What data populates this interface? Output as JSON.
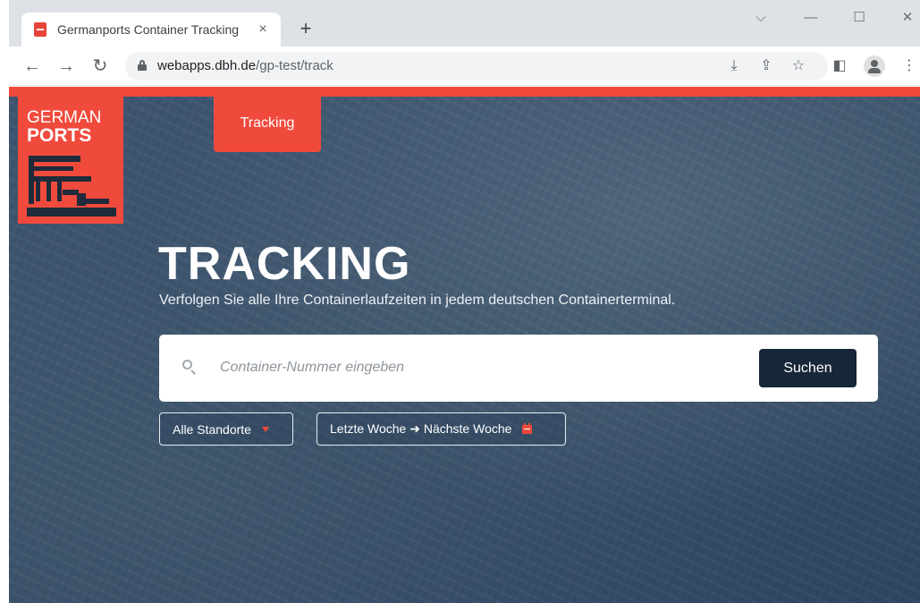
{
  "browser": {
    "tab_title": "Germanports Container Tracking",
    "tab_close": "×",
    "new_tab": "+",
    "window_controls": {
      "dropdown": "⌵",
      "minimize": "—",
      "maximize": "☐",
      "close": "✕"
    },
    "nav": {
      "back": "←",
      "forward": "→",
      "reload": "↻"
    },
    "url_domain": "webapps.dbh.de",
    "url_path": "/gp-test/track",
    "toolbar_icons": [
      "download-icon",
      "share-icon",
      "star-icon",
      "side-panel-icon",
      "profile-icon",
      "menu-icon"
    ],
    "toolbar": {
      "download": "⤓",
      "share": "⇪",
      "star": "☆",
      "side_panel": "◧",
      "menu": "⋮"
    }
  },
  "site": {
    "brand_color": "#f04a3c",
    "dark_color": "#172639",
    "logo": {
      "line1": "GERMAN",
      "line2": "PORTS"
    },
    "nav_items": [
      {
        "label": "Tracking",
        "active": true
      }
    ],
    "hero": {
      "title": "TRACKING",
      "subtitle": "Verfolgen Sie alle Ihre Containerlaufzeiten in jedem deutschen Containerterminal."
    },
    "search": {
      "placeholder": "Container-Nummer eingeben",
      "value": "",
      "button_label": "Suchen"
    },
    "filters": {
      "location": "Alle Standorte",
      "date_range": "Letzte Woche ➜ Nächste Woche"
    }
  }
}
